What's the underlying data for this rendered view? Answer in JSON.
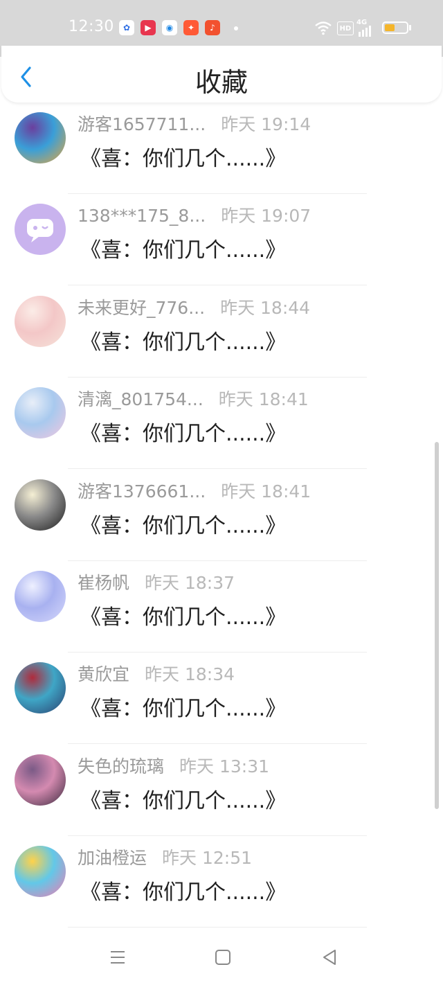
{
  "status_bar": {
    "time": "12:30",
    "app_icons": [
      {
        "name": "baidu-icon",
        "color": "#2f6fe4",
        "glyph": "✿"
      },
      {
        "name": "video-icon",
        "color": "#e8364f",
        "glyph": "▶"
      },
      {
        "name": "browser-icon",
        "color": "#1e88e5",
        "glyph": "◉"
      },
      {
        "name": "kuaishou-icon",
        "color": "#ff5a36",
        "glyph": "✦"
      },
      {
        "name": "music-icon",
        "color": "#f2512f",
        "glyph": "♪"
      }
    ],
    "hd_label": "HD",
    "network_label": "4G",
    "battery_color": "#f4b52b"
  },
  "header": {
    "title": "收藏"
  },
  "favorites": [
    {
      "name": "游客1657711...",
      "time": "昨天 19:14",
      "content": "《喜：你们几个......》",
      "avatar_colors": [
        "#e7a53b",
        "#3a9fd8",
        "#6b3f9e"
      ]
    },
    {
      "name": "138***175_8...",
      "time": "昨天 19:07",
      "content": "《喜：你们几个......》",
      "avatar_colors": [
        "#c9b3ee",
        "#c9b3ee",
        "#ffffff"
      ]
    },
    {
      "name": "未来更好_776...",
      "time": "昨天 18:44",
      "content": "《喜：你们几个......》",
      "avatar_colors": [
        "#f6e3da",
        "#f3c7c7",
        "#fbece7"
      ]
    },
    {
      "name": "清漓_801754...",
      "time": "昨天 18:41",
      "content": "《喜：你们几个......》",
      "avatar_colors": [
        "#f3c8e0",
        "#a8c9ee",
        "#e8eef8"
      ]
    },
    {
      "name": "游客1376661...",
      "time": "昨天 18:41",
      "content": "《喜：你们几个......》",
      "avatar_colors": [
        "#1c1c1c",
        "#8a8a8a",
        "#f5efd4"
      ]
    },
    {
      "name": "崔杨帆",
      "time": "昨天 18:37",
      "content": "《喜：你们几个......》",
      "avatar_colors": [
        "#d6d8fb",
        "#a8b1f0",
        "#eef0ff"
      ]
    },
    {
      "name": "黄欣宜",
      "time": "昨天 18:34",
      "content": "《喜：你们几个......》",
      "avatar_colors": [
        "#2b3f6e",
        "#3fa6c6",
        "#b02b3c"
      ]
    },
    {
      "name": "失色的琉璃",
      "time": "昨天 13:31",
      "content": "《喜：你们几个......》",
      "avatar_colors": [
        "#3b2a3e",
        "#d48ab0",
        "#7a5a86"
      ]
    },
    {
      "name": "加油橙运",
      "time": "昨天 12:51",
      "content": "《喜：你们几个......》",
      "avatar_colors": [
        "#f27ab0",
        "#62c8e8",
        "#ffd24a"
      ]
    }
  ],
  "colors": {
    "accent": "#1e90e6"
  }
}
